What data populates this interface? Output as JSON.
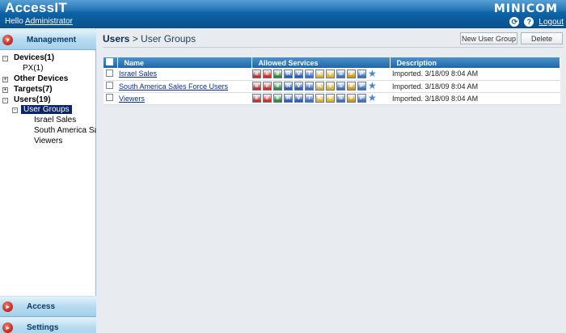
{
  "header": {
    "app_title": "AccessIT",
    "hello_prefix": "Hello",
    "user": "Administrator",
    "brand": "MINICOM",
    "logout": "Logout"
  },
  "sidebar": {
    "sections": [
      {
        "label": "Management"
      },
      {
        "label": "Access"
      },
      {
        "label": "Settings"
      }
    ],
    "tree": {
      "devices": "Devices(1)",
      "px": "PX(1)",
      "other_devices": "Other Devices",
      "targets": "Targets(7)",
      "users": "Users(19)",
      "user_groups": "User Groups",
      "groups": [
        "Israel Sales",
        "South America Sa",
        "Viewers"
      ]
    }
  },
  "main": {
    "breadcrumb_root": "Users",
    "breadcrumb_sep": " > ",
    "breadcrumb_page": "User Groups",
    "buttons": {
      "new": "New User Group",
      "delete": "Delete"
    },
    "columns": [
      "Name",
      "Allowed Services",
      "Description"
    ],
    "rows": [
      {
        "name": "Israel Sales",
        "description": "Imported. 3/18/09 8:04 AM"
      },
      {
        "name": "South America Sales Force Users",
        "description": "Imported. 3/18/09 8:04 AM"
      },
      {
        "name": "Viewers",
        "description": "Imported. 3/18/09 8:04 AM"
      }
    ],
    "service_icons": [
      {
        "name": "web-service-icon",
        "color": "#c8322a",
        "glyph": "e"
      },
      {
        "name": "web-admin-icon",
        "color": "#c8322a",
        "glyph": "e"
      },
      {
        "name": "ssh-icon",
        "color": "#2f8a3a",
        "glyph": "e"
      },
      {
        "name": "rdp-icon",
        "color": "#2a5fb8",
        "glyph": "R"
      },
      {
        "name": "vnc-icon",
        "color": "#2a5fb8",
        "glyph": "V"
      },
      {
        "name": "telnet-icon",
        "color": "#3a72c8",
        "glyph": "T"
      },
      {
        "name": "kvm-icon",
        "color": "#d8b23a",
        "glyph": "K"
      },
      {
        "name": "vncv-icon",
        "color": "#d8b23a",
        "glyph": "V"
      },
      {
        "name": "serial-icon",
        "color": "#3a72c8",
        "glyph": "S"
      },
      {
        "name": "power-grid-icon",
        "color": "#c89a2a",
        "glyph": "#"
      },
      {
        "name": "power-icon",
        "color": "#3a72c8",
        "glyph": "P"
      }
    ]
  }
}
